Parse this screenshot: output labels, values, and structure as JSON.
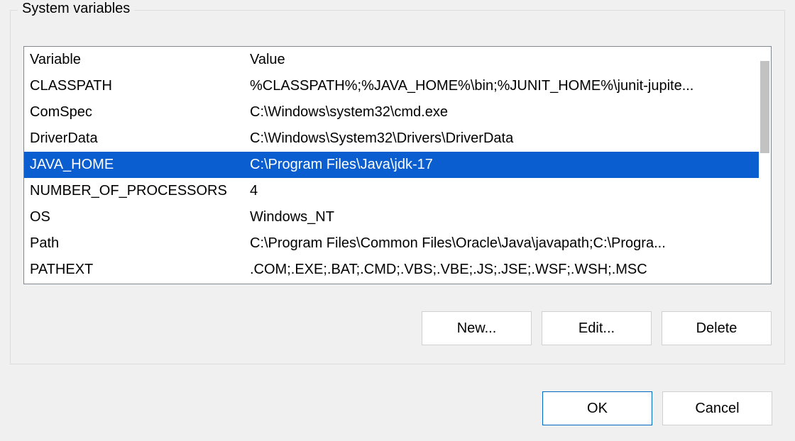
{
  "group": {
    "title": "System variables"
  },
  "columns": {
    "variable": "Variable",
    "value": "Value"
  },
  "rows": [
    {
      "variable": "CLASSPATH",
      "value": "%CLASSPATH%;%JAVA_HOME%\\bin;%JUNIT_HOME%\\junit-jupite...",
      "selected": false
    },
    {
      "variable": "ComSpec",
      "value": "C:\\Windows\\system32\\cmd.exe",
      "selected": false
    },
    {
      "variable": "DriverData",
      "value": "C:\\Windows\\System32\\Drivers\\DriverData",
      "selected": false
    },
    {
      "variable": "JAVA_HOME",
      "value": "C:\\Program Files\\Java\\jdk-17",
      "selected": true
    },
    {
      "variable": "NUMBER_OF_PROCESSORS",
      "value": "4",
      "selected": false
    },
    {
      "variable": "OS",
      "value": "Windows_NT",
      "selected": false
    },
    {
      "variable": "Path",
      "value": "C:\\Program Files\\Common Files\\Oracle\\Java\\javapath;C:\\Progra...",
      "selected": false
    },
    {
      "variable": "PATHEXT",
      "value": ".COM;.EXE;.BAT;.CMD;.VBS;.VBE;.JS;.JSE;.WSF;.WSH;.MSC",
      "selected": false
    }
  ],
  "buttons": {
    "new": "New...",
    "edit": "Edit...",
    "delete": "Delete",
    "ok": "OK",
    "cancel": "Cancel"
  }
}
